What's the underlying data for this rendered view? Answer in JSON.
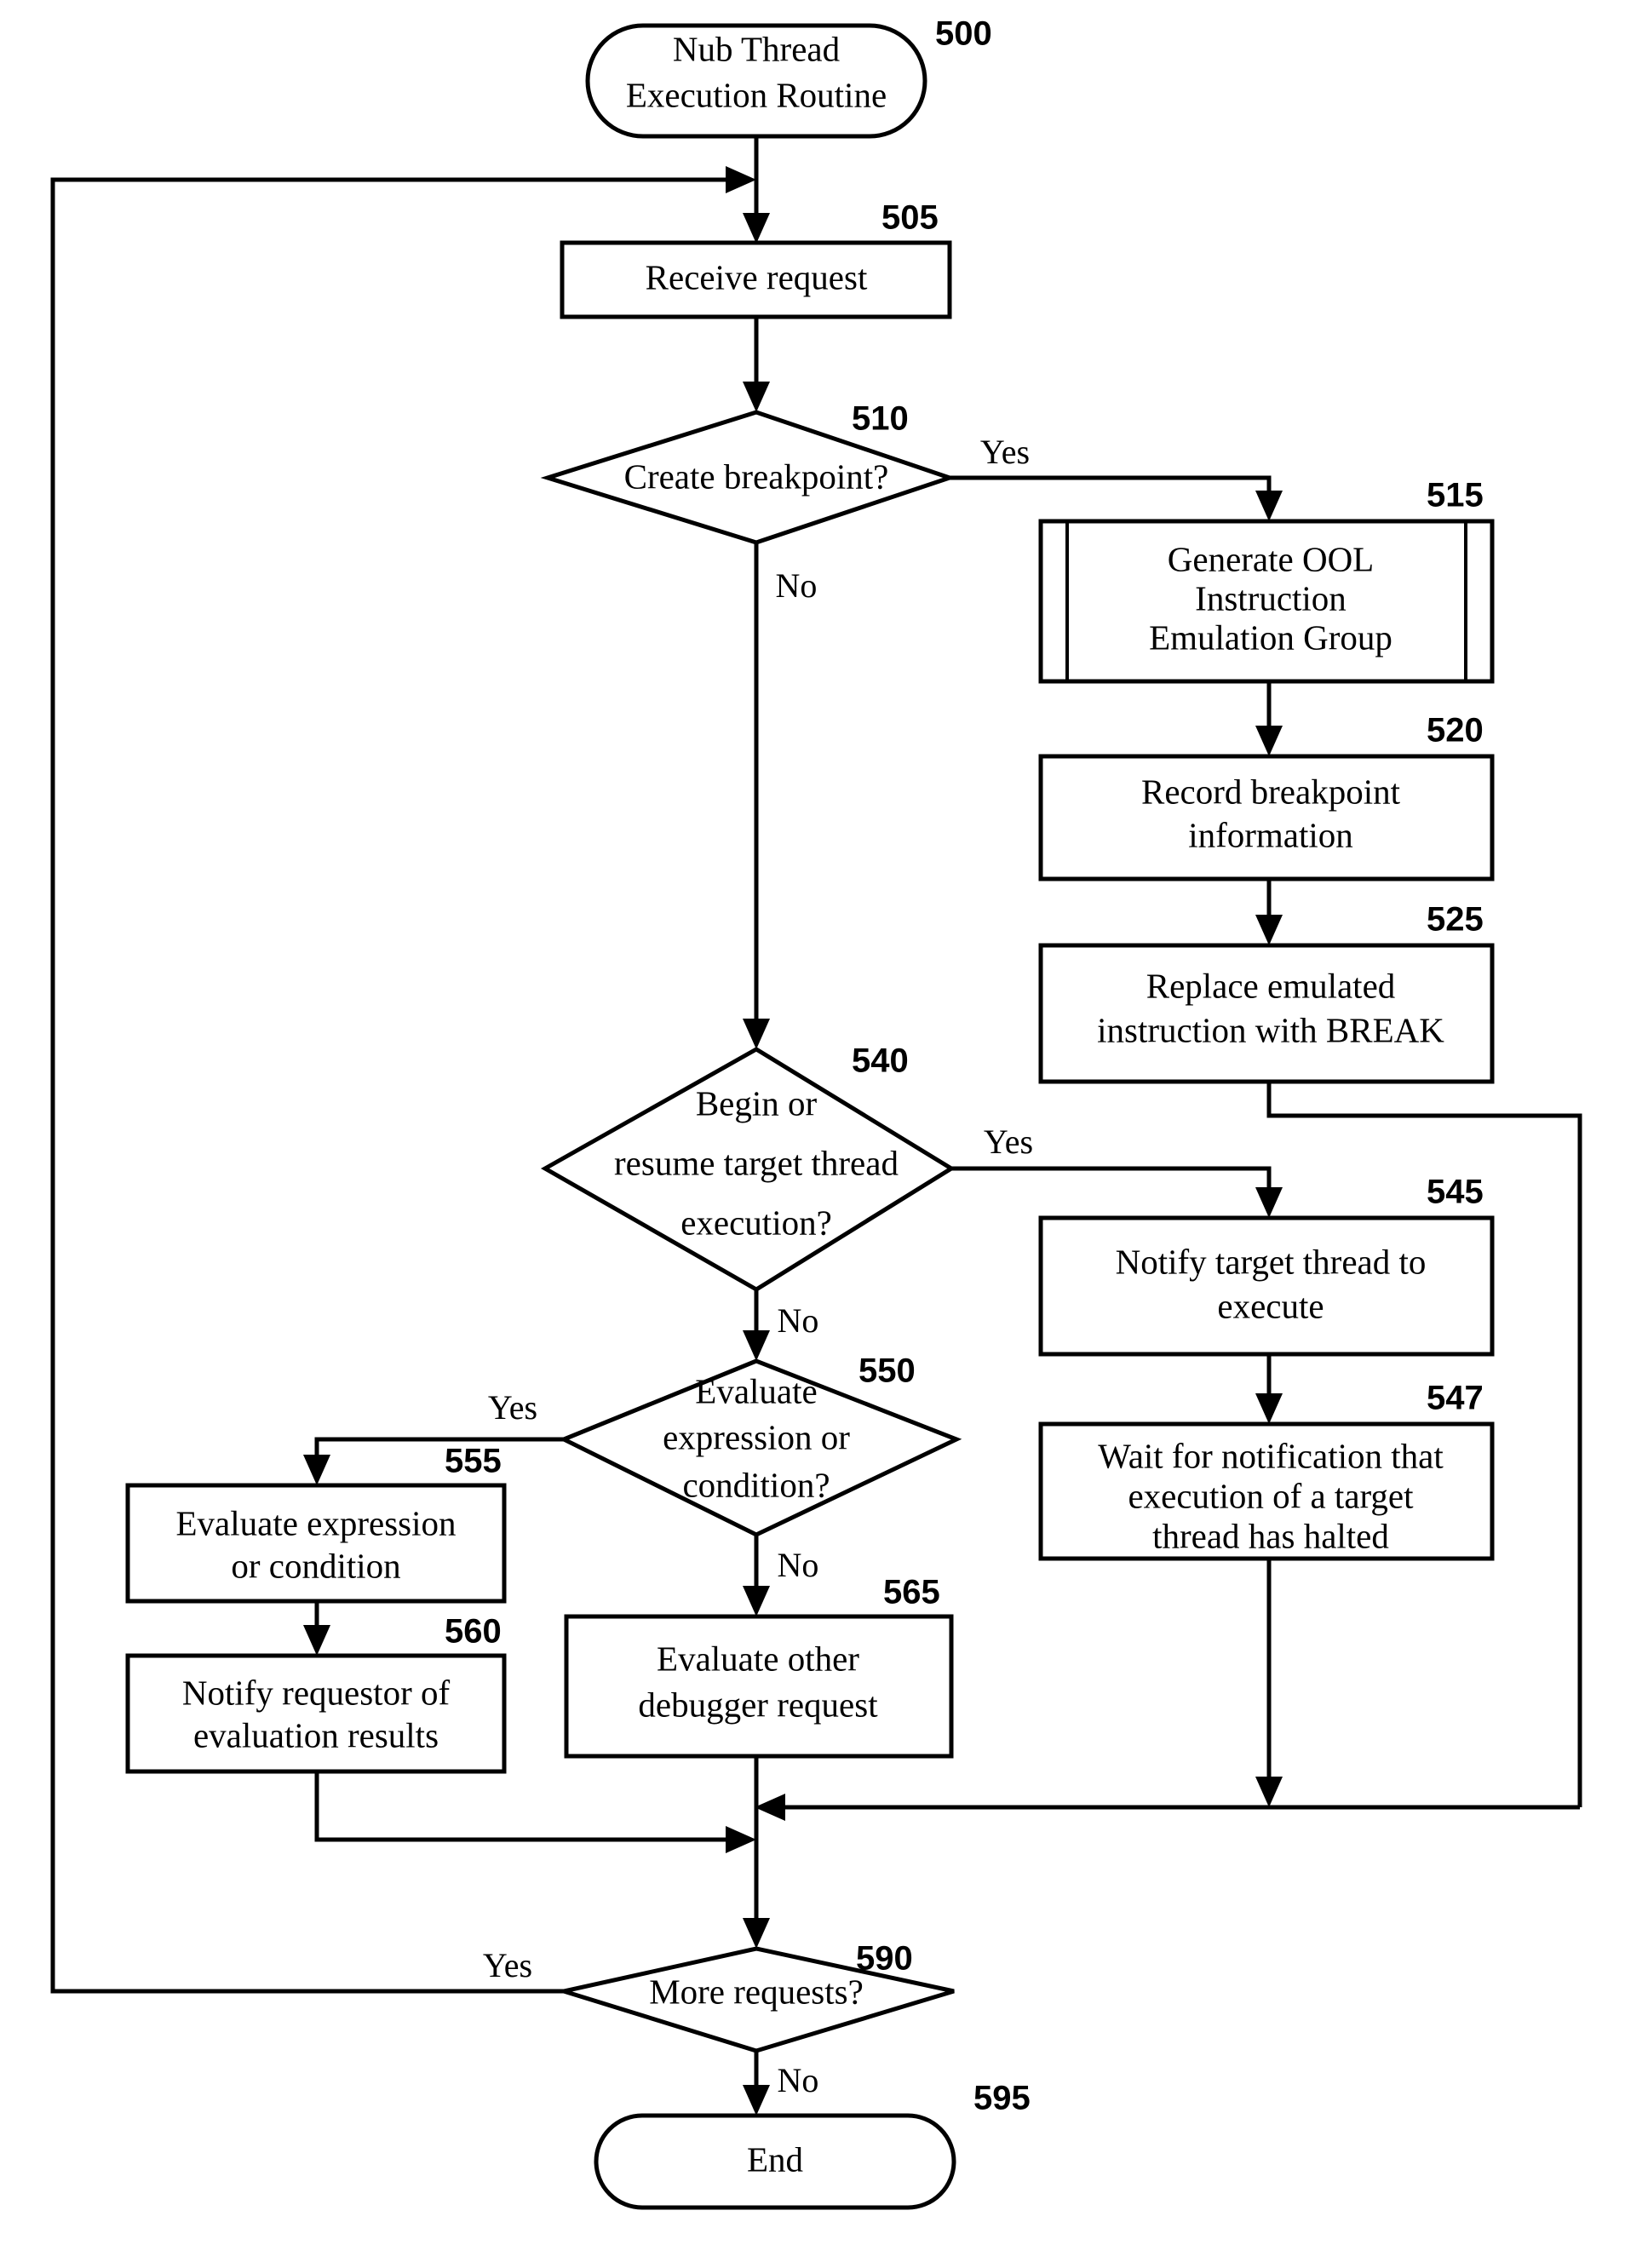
{
  "diagram": {
    "title": "Nub Thread Execution Routine Flowchart",
    "nodes": [
      {
        "id": "n500",
        "ref": "500",
        "type": "terminator",
        "text_lines": [
          "Nub Thread",
          "Execution Routine"
        ]
      },
      {
        "id": "n505",
        "ref": "505",
        "type": "process",
        "text_lines": [
          "Receive request"
        ]
      },
      {
        "id": "n510",
        "ref": "510",
        "type": "decision",
        "text_lines": [
          "Create breakpoint?"
        ]
      },
      {
        "id": "n515",
        "ref": "515",
        "type": "predefined-process",
        "text_lines": [
          "Generate OOL",
          "Instruction",
          "Emulation Group"
        ]
      },
      {
        "id": "n520",
        "ref": "520",
        "type": "process",
        "text_lines": [
          "Record breakpoint",
          "information"
        ]
      },
      {
        "id": "n525",
        "ref": "525",
        "type": "process",
        "text_lines": [
          "Replace emulated",
          "instruction with BREAK"
        ]
      },
      {
        "id": "n540",
        "ref": "540",
        "type": "decision",
        "text_lines": [
          "Begin or",
          "resume target thread",
          "execution?"
        ]
      },
      {
        "id": "n545",
        "ref": "545",
        "type": "process",
        "text_lines": [
          "Notify target thread to",
          "execute"
        ]
      },
      {
        "id": "n547",
        "ref": "547",
        "type": "process",
        "text_lines": [
          "Wait for notification that",
          "execution of a target",
          "thread has halted"
        ]
      },
      {
        "id": "n550",
        "ref": "550",
        "type": "decision",
        "text_lines": [
          "Evaluate",
          "expression or",
          "condition?"
        ]
      },
      {
        "id": "n555",
        "ref": "555",
        "type": "process",
        "text_lines": [
          "Evaluate expression",
          "or condition"
        ]
      },
      {
        "id": "n560",
        "ref": "560",
        "type": "process",
        "text_lines": [
          "Notify requestor of",
          "evaluation results"
        ]
      },
      {
        "id": "n565",
        "ref": "565",
        "type": "process",
        "text_lines": [
          "Evaluate other",
          "debugger request"
        ]
      },
      {
        "id": "n590",
        "ref": "590",
        "type": "decision",
        "text_lines": [
          "More requests?"
        ]
      },
      {
        "id": "n595",
        "ref": "595",
        "type": "terminator",
        "text_lines": [
          "End"
        ]
      }
    ],
    "edge_labels": [
      {
        "id": "e510yes",
        "text": "Yes",
        "from": "n510",
        "to": "n515"
      },
      {
        "id": "e510no",
        "text": "No",
        "from": "n510",
        "to": "n540"
      },
      {
        "id": "e540yes",
        "text": "Yes",
        "from": "n540",
        "to": "n545"
      },
      {
        "id": "e540no",
        "text": "No",
        "from": "n540",
        "to": "n550"
      },
      {
        "id": "e550yes",
        "text": "Yes",
        "from": "n550",
        "to": "n555"
      },
      {
        "id": "e550no",
        "text": "No",
        "from": "n550",
        "to": "n565"
      },
      {
        "id": "e590yes",
        "text": "Yes",
        "from": "n590",
        "to": "n505"
      },
      {
        "id": "e590no",
        "text": "No",
        "from": "n590",
        "to": "n595"
      }
    ],
    "colors": {
      "stroke": "#000000",
      "fill": "#ffffff",
      "text": "#000000"
    }
  }
}
